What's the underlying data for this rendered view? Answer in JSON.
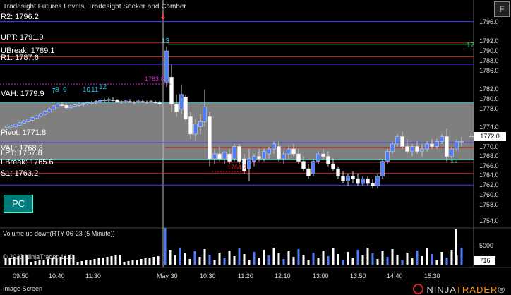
{
  "header": {
    "title": "Tradesight Futures Levels, Tradesight Seeker and Comber"
  },
  "float_button": "F",
  "pc_button": "PC",
  "levels": [
    {
      "name": "R2",
      "label": "R2: 1796.2",
      "price": 1796.2,
      "color": "#4040ff"
    },
    {
      "name": "UPT",
      "label": "UPT: 1791.9",
      "price": 1791.9,
      "color": "#c02020"
    },
    {
      "name": "UBreak",
      "label": "UBreak: 1789.1",
      "price": 1789.1,
      "color": "#c02020"
    },
    {
      "name": "R1",
      "label": "R1: 1787.6",
      "price": 1787.6,
      "color": "#4040ff"
    },
    {
      "name": "VAH",
      "label": "VAH: 1779.9",
      "price": 1779.9,
      "color": "#20d0d0"
    },
    {
      "name": "Pivot",
      "label": "Pivot: 1771.8",
      "price": 1771.8,
      "color": "#4040ff"
    },
    {
      "name": "VAL",
      "label": "VAL: 1768.3",
      "price": 1768.3,
      "color": "#20d0d0"
    },
    {
      "name": "LPT",
      "label": "LPT: 1767.8",
      "price": 1767.8,
      "color": "#c02020"
    },
    {
      "name": "LBreak",
      "label": "LBreak: 1765.6",
      "price": 1765.6,
      "color": "#c02020"
    },
    {
      "name": "S1",
      "label": "S1: 1763.2",
      "price": 1763.2,
      "color": "#4040ff"
    }
  ],
  "y_ticks": [
    "1796.0",
    "1792.0",
    "1790.0",
    "1788.0",
    "1786.0",
    "1782.0",
    "1780.0",
    "1778.0",
    "1774.0",
    "1770.0",
    "1768.0",
    "1766.0",
    "1764.0",
    "1762.0",
    "1760.0",
    "1758.0",
    "1754.0"
  ],
  "current_price": "1772.0",
  "x_ticks": [
    "09:50",
    "10:40",
    "11:30",
    "May 30",
    "10:30",
    "11:20",
    "12:10",
    "13:00",
    "13:50",
    "14:40",
    "15:30"
  ],
  "volume": {
    "title": "Volume up down(RTY 06-23 (5 Minute))",
    "tick": "5000",
    "current": "716"
  },
  "annotations": {
    "counts": [
      "7",
      "8",
      "9",
      "10",
      "11",
      "12",
      "13",
      "17",
      "12"
    ],
    "price_marks": [
      "1783.8",
      "1764.7"
    ]
  },
  "copyright": "© 2023 NinjaTrader, LLC",
  "status": "Image Screen",
  "brand": {
    "ninja": "NINJA",
    "trader": "TRADER",
    "reg": "®"
  },
  "colors": {
    "up": "#4a7dff",
    "down": "#ffffff",
    "value_area": "#808080",
    "bg": "#000000"
  }
}
